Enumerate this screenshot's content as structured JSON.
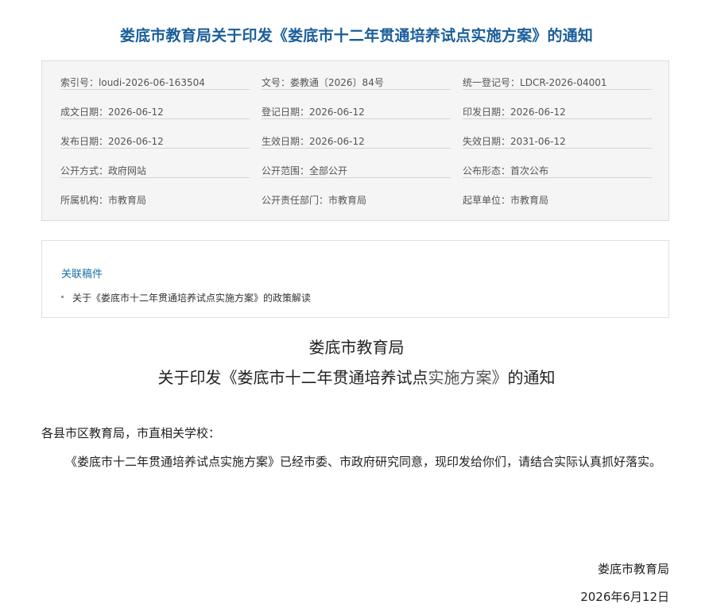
{
  "page_title": "娄底市教育局关于印发《娄底市十二年贯通培养试点实施方案》的通知",
  "colors": {
    "title_blue": "#1a5e9a",
    "link_blue": "#1a6fa8",
    "meta_background": "#f5f5f5"
  },
  "meta": {
    "index_no": {
      "label": "索引号：",
      "value": "loudi-2026-06-163504"
    },
    "doc_no": {
      "label": "文号：",
      "value": "娄教通〔2026〕84号"
    },
    "registration_no": {
      "label": "统一登记号：",
      "value": "LDCR-2026-04001"
    },
    "written_date": {
      "label": "成文日期：",
      "value": "2026-06-12"
    },
    "registered_date": {
      "label": "登记日期：",
      "value": "2026-06-12"
    },
    "printed_date": {
      "label": "印发日期：",
      "value": "2026-06-12"
    },
    "published_date": {
      "label": "发布日期：",
      "value": "2026-06-12"
    },
    "effective_date": {
      "label": "生效日期：",
      "value": "2026-06-12"
    },
    "expiry_date": {
      "label": "失效日期：",
      "value": "2031-06-12"
    },
    "disclosure_method": {
      "label": "公开方式：",
      "value": "政府网站"
    },
    "disclosure_scope": {
      "label": "公开范围：",
      "value": "全部公开"
    },
    "release_form": {
      "label": "公布形态：",
      "value": "首次公布"
    },
    "agency": {
      "label": "所属机构：",
      "value": "市教育局"
    },
    "responsible_dept": {
      "label": "公开责任部门：",
      "value": "市教育局"
    },
    "drafting_unit": {
      "label": "起草单位：",
      "value": "市教育局"
    }
  },
  "related": {
    "title": "关联稿件",
    "items": [
      "关于《娄底市十二年贯通培养试点实施方案》的政策解读"
    ]
  },
  "document": {
    "issuer_heading": "娄底市教育局",
    "subject_part1": "关于印发《娄底市十二年贯通培养试点",
    "subject_part2": "实施方案》",
    "subject_part3": "的通知",
    "salutation": "各县市区教育局，市直相关学校：",
    "body": "《娄底市十二年贯通培养试点实施方案》已经市委、市政府研究同意，现印发给你们，请结合实际认真抓好落实。",
    "signature_org": "娄底市教育局",
    "signature_date": "2026年6月12日"
  }
}
